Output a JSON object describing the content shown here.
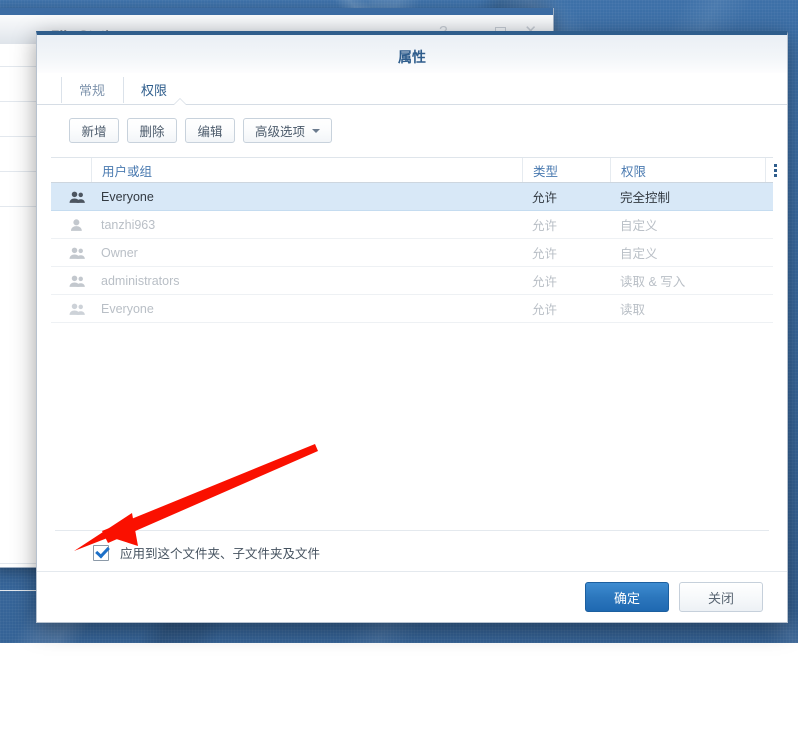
{
  "desktop": {
    "background_color": "#3a6ca3"
  },
  "background_window": {
    "title": "File Station",
    "controls": [
      {
        "name": "help",
        "glyph": "?"
      },
      {
        "name": "minimize",
        "glyph": "−"
      },
      {
        "name": "maximize",
        "glyph": "□"
      },
      {
        "name": "close",
        "glyph": "✕"
      }
    ]
  },
  "dialog": {
    "title": "属性",
    "accent_color": "#2f5d8c",
    "tabs": [
      {
        "label": "常规",
        "active": false
      },
      {
        "label": "权限",
        "active": true
      }
    ],
    "toolbar": [
      {
        "label": "新增",
        "has_caret": false
      },
      {
        "label": "删除",
        "has_caret": false
      },
      {
        "label": "编辑",
        "has_caret": false
      },
      {
        "label": "高级选项",
        "has_caret": true
      }
    ],
    "grid": {
      "columns": [
        "",
        "用户或组",
        "类型",
        "权限",
        ""
      ],
      "column_menu_icon": "kebab-menu-icon",
      "rows": [
        {
          "icon": "group-icon",
          "user": "Everyone",
          "type": "允许",
          "permission": "完全控制",
          "selected": true
        },
        {
          "icon": "user-icon",
          "user": "tanzhi963",
          "type": "允许",
          "permission": "自定义",
          "selected": false
        },
        {
          "icon": "group-icon",
          "user": "Owner",
          "type": "允许",
          "permission": "自定义",
          "selected": false
        },
        {
          "icon": "group-icon",
          "user": "administrators",
          "type": "允许",
          "permission": "读取 & 写入",
          "selected": false
        },
        {
          "icon": "group-icon",
          "user": "Everyone",
          "type": "允许",
          "permission": "读取",
          "selected": false
        }
      ]
    },
    "apply_checkbox": {
      "label": "应用到这个文件夹、子文件夹及文件",
      "checked": true
    },
    "footer": {
      "confirm_label": "确定",
      "close_label": "关闭"
    }
  },
  "annotation": {
    "type": "arrow",
    "color": "#fa1000",
    "points_at": "apply-checkbox"
  }
}
